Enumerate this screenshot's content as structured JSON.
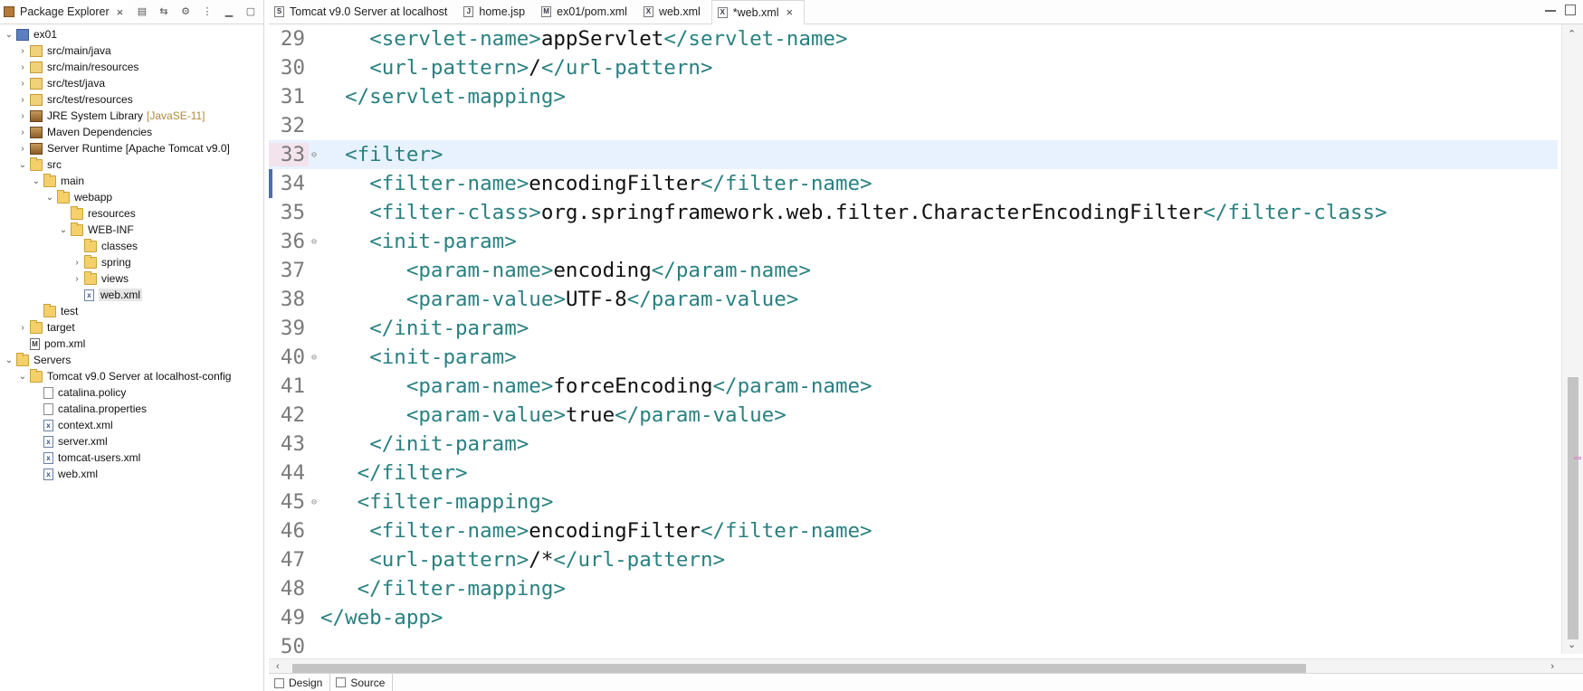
{
  "explorer": {
    "tab_label": "Package Explorer",
    "tab_close": "×",
    "items": [
      {
        "label": "ex01",
        "indent": 0,
        "twisty": "v",
        "icon": "proj"
      },
      {
        "label": "src/main/java",
        "indent": 1,
        "twisty": ">",
        "icon": "pkgf"
      },
      {
        "label": "src/main/resources",
        "indent": 1,
        "twisty": ">",
        "icon": "pkgf"
      },
      {
        "label": "src/test/java",
        "indent": 1,
        "twisty": ">",
        "icon": "pkgf"
      },
      {
        "label": "src/test/resources",
        "indent": 1,
        "twisty": ">",
        "icon": "pkgf"
      },
      {
        "label": "JRE System Library",
        "extra": "[JavaSE-11]",
        "indent": 1,
        "twisty": ">",
        "icon": "lib"
      },
      {
        "label": "Maven Dependencies",
        "indent": 1,
        "twisty": ">",
        "icon": "lib"
      },
      {
        "label": "Server Runtime [Apache Tomcat v9.0]",
        "indent": 1,
        "twisty": ">",
        "icon": "lib"
      },
      {
        "label": "src",
        "indent": 1,
        "twisty": "v",
        "icon": "folder"
      },
      {
        "label": "main",
        "indent": 2,
        "twisty": "v",
        "icon": "folder"
      },
      {
        "label": "webapp",
        "indent": 3,
        "twisty": "v",
        "icon": "folder"
      },
      {
        "label": "resources",
        "indent": 4,
        "twisty": "",
        "icon": "folder"
      },
      {
        "label": "WEB-INF",
        "indent": 4,
        "twisty": "v",
        "icon": "folder"
      },
      {
        "label": "classes",
        "indent": 5,
        "twisty": "",
        "icon": "folder"
      },
      {
        "label": "spring",
        "indent": 5,
        "twisty": ">",
        "icon": "folder"
      },
      {
        "label": "views",
        "indent": 5,
        "twisty": ">",
        "icon": "folder"
      },
      {
        "label": "web.xml",
        "indent": 5,
        "twisty": "",
        "icon": "xfile",
        "selected": true
      },
      {
        "label": "test",
        "indent": 2,
        "twisty": "",
        "icon": "folder"
      },
      {
        "label": "target",
        "indent": 1,
        "twisty": ">",
        "icon": "folder"
      },
      {
        "label": "pom.xml",
        "indent": 1,
        "twisty": "",
        "icon": "mfile"
      },
      {
        "label": "Servers",
        "indent": 0,
        "twisty": "v",
        "icon": "folder"
      },
      {
        "label": "Tomcat v9.0 Server at localhost-config",
        "indent": 1,
        "twisty": "v",
        "icon": "folder"
      },
      {
        "label": "catalina.policy",
        "indent": 2,
        "twisty": "",
        "icon": "file"
      },
      {
        "label": "catalina.properties",
        "indent": 2,
        "twisty": "",
        "icon": "file"
      },
      {
        "label": "context.xml",
        "indent": 2,
        "twisty": "",
        "icon": "xfile"
      },
      {
        "label": "server.xml",
        "indent": 2,
        "twisty": "",
        "icon": "xfile"
      },
      {
        "label": "tomcat-users.xml",
        "indent": 2,
        "twisty": "",
        "icon": "xfile"
      },
      {
        "label": "web.xml",
        "indent": 2,
        "twisty": "",
        "icon": "xfile"
      }
    ]
  },
  "editor": {
    "tabs": [
      {
        "label": "Tomcat v9.0 Server at localhost",
        "icon": "S",
        "active": false
      },
      {
        "label": "home.jsp",
        "icon": "J",
        "active": false
      },
      {
        "label": "ex01/pom.xml",
        "icon": "M",
        "active": false
      },
      {
        "label": "web.xml",
        "icon": "X",
        "active": false
      },
      {
        "label": "*web.xml",
        "icon": "X",
        "active": true
      }
    ],
    "tab_close": "×",
    "lines": [
      {
        "n": "29",
        "indent": "    ",
        "parts": [
          [
            "tag",
            "<servlet-name>"
          ],
          [
            "cx",
            "appServlet"
          ],
          [
            "tag",
            "</servlet-name>"
          ]
        ]
      },
      {
        "n": "30",
        "indent": "    ",
        "parts": [
          [
            "tag",
            "<url-pattern>"
          ],
          [
            "cx",
            "/"
          ],
          [
            "tag",
            "</url-pattern>"
          ]
        ]
      },
      {
        "n": "31",
        "indent": "  ",
        "parts": [
          [
            "tag",
            "</servlet-mapping>"
          ]
        ]
      },
      {
        "n": "32",
        "indent": "",
        "parts": []
      },
      {
        "n": "33",
        "indent": "  ",
        "fold": true,
        "current": true,
        "parts": [
          [
            "tag",
            "<filter>"
          ]
        ]
      },
      {
        "n": "34",
        "indent": "    ",
        "parts": [
          [
            "tag",
            "<filter-name>"
          ],
          [
            "cx",
            "encodingFilter"
          ],
          [
            "tag",
            "</filter-name>"
          ]
        ]
      },
      {
        "n": "35",
        "indent": "    ",
        "parts": [
          [
            "tag",
            "<filter-class>"
          ],
          [
            "cx",
            "org.springframework.web.filter.CharacterEncodingFilter"
          ],
          [
            "tag",
            "</filter-class>"
          ]
        ]
      },
      {
        "n": "36",
        "indent": "    ",
        "fold": true,
        "parts": [
          [
            "tag",
            "<init-param>"
          ]
        ]
      },
      {
        "n": "37",
        "indent": "       ",
        "parts": [
          [
            "tag",
            "<param-name>"
          ],
          [
            "cx",
            "encoding"
          ],
          [
            "tag",
            "</param-name>"
          ]
        ]
      },
      {
        "n": "38",
        "indent": "       ",
        "parts": [
          [
            "tag",
            "<param-value>"
          ],
          [
            "cx",
            "UTF-8"
          ],
          [
            "tag",
            "</param-value>"
          ]
        ]
      },
      {
        "n": "39",
        "indent": "    ",
        "parts": [
          [
            "tag",
            "</init-param>"
          ]
        ]
      },
      {
        "n": "40",
        "indent": "    ",
        "fold": true,
        "parts": [
          [
            "tag",
            "<init-param>"
          ]
        ]
      },
      {
        "n": "41",
        "indent": "       ",
        "parts": [
          [
            "tag",
            "<param-name>"
          ],
          [
            "cx",
            "forceEncoding"
          ],
          [
            "tag",
            "</param-name>"
          ]
        ]
      },
      {
        "n": "42",
        "indent": "       ",
        "parts": [
          [
            "tag",
            "<param-value>"
          ],
          [
            "cx",
            "true"
          ],
          [
            "tag",
            "</param-value>"
          ]
        ]
      },
      {
        "n": "43",
        "indent": "    ",
        "parts": [
          [
            "tag",
            "</init-param>"
          ]
        ]
      },
      {
        "n": "44",
        "indent": "   ",
        "parts": [
          [
            "tag",
            "</filter>"
          ]
        ]
      },
      {
        "n": "45",
        "indent": "   ",
        "fold": true,
        "parts": [
          [
            "tag",
            "<filter-mapping>"
          ]
        ]
      },
      {
        "n": "46",
        "indent": "    ",
        "parts": [
          [
            "tag",
            "<filter-name>"
          ],
          [
            "cx",
            "encodingFilter"
          ],
          [
            "tag",
            "</filter-name>"
          ]
        ]
      },
      {
        "n": "47",
        "indent": "    ",
        "parts": [
          [
            "tag",
            "<url-pattern>"
          ],
          [
            "cx",
            "/*"
          ],
          [
            "tag",
            "</url-pattern>"
          ]
        ]
      },
      {
        "n": "48",
        "indent": "   ",
        "parts": [
          [
            "tag",
            "</filter-mapping>"
          ]
        ]
      },
      {
        "n": "49",
        "indent": "",
        "parts": [
          [
            "tag",
            "</web-app>"
          ]
        ]
      },
      {
        "n": "50",
        "indent": "",
        "parts": []
      }
    ],
    "bottom_tabs": [
      {
        "label": "Design",
        "active": false
      },
      {
        "label": "Source",
        "active": true
      }
    ]
  },
  "colors": {
    "tag": "#2a8080",
    "text": "#111111",
    "current_line": "#e8f2fe"
  }
}
